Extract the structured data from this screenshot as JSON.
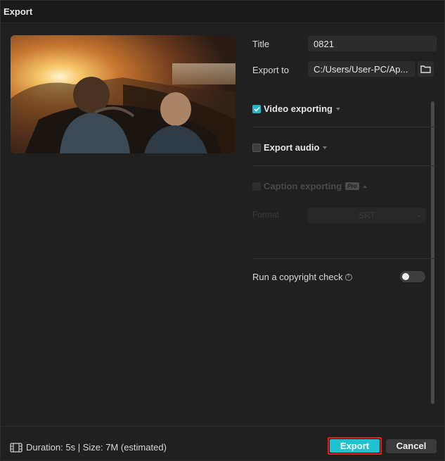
{
  "window": {
    "title": "Export"
  },
  "form": {
    "title_label": "Title",
    "title_value": "0821",
    "export_to_label": "Export to",
    "export_to_value": "C:/Users/User-PC/Ap..."
  },
  "sections": {
    "video": {
      "label": "Video exporting",
      "checked": true
    },
    "audio": {
      "label": "Export audio",
      "checked": false
    },
    "caption": {
      "label": "Caption exporting",
      "badge": "Pro",
      "enabled": false
    },
    "format": {
      "label": "Format",
      "value": "SRT"
    }
  },
  "copyright": {
    "label": "Run a copyright check",
    "help_icon": "question-circle-icon",
    "enabled": false
  },
  "footer": {
    "film_icon": "film-icon",
    "info": "Duration: 5s | Size: 7M (estimated)",
    "export_label": "Export",
    "cancel_label": "Cancel"
  },
  "colors": {
    "accent": "#20c2cf",
    "highlight_outline": "#e0201f",
    "background": "#202020"
  }
}
